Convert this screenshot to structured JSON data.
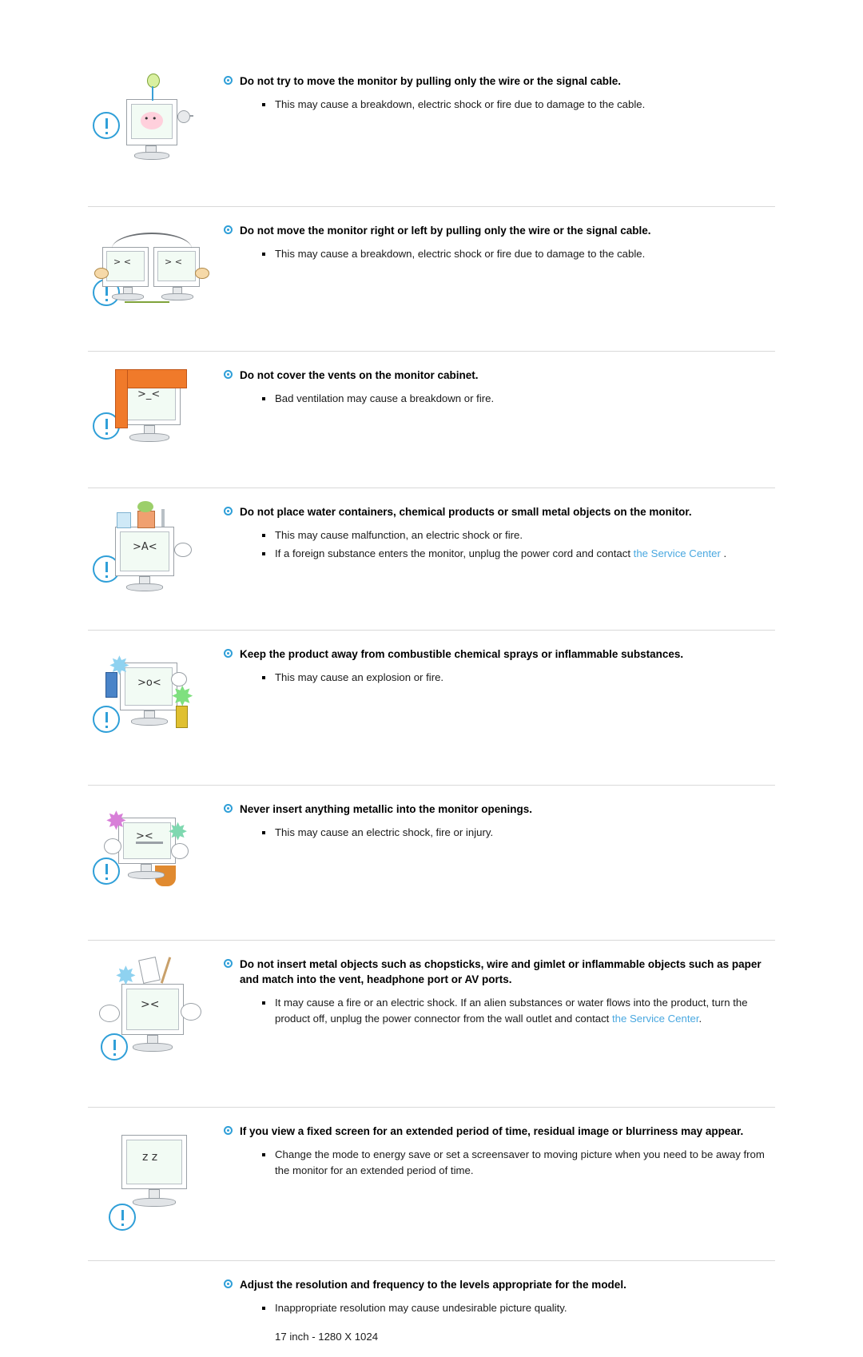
{
  "document": {
    "sections": [
      {
        "id": "move-by-cable",
        "heading": "Do not try to move the monitor by pulling only the wire or the signal cable.",
        "items": [
          "This may cause a breakdown, electric shock or fire due to damage to the cable."
        ]
      },
      {
        "id": "move-right-left",
        "heading": "Do not move the monitor right or left by pulling only the wire or the signal cable.",
        "items": [
          "This may cause a breakdown, electric shock or fire due to damage to the cable."
        ]
      },
      {
        "id": "cover-vents",
        "heading": "Do not cover the vents on the monitor cabinet.",
        "items": [
          "Bad ventilation may cause a breakdown or fire."
        ]
      },
      {
        "id": "water-containers",
        "heading": "Do not place water containers, chemical products or small metal objects on the monitor.",
        "items": [
          "This may cause malfunction, an electric shock or fire."
        ],
        "items_rich": [
          {
            "pre": "If a foreign substance enters the monitor, unplug the power cord and contact ",
            "link": "the Service Center",
            "post": " ."
          }
        ]
      },
      {
        "id": "combustible-sprays",
        "heading": "Keep the product away from combustible chemical sprays or inflammable substances.",
        "items": [
          "This may cause an explosion or fire."
        ]
      },
      {
        "id": "metallic-openings",
        "heading": "Never insert anything metallic into the monitor openings.",
        "items": [
          "This may cause an electric shock, fire or injury."
        ]
      },
      {
        "id": "metal-objects-vent",
        "heading": "Do not insert metal objects such as chopsticks, wire and gimlet or inflammable objects such as paper and match into the vent, headphone port or AV ports.",
        "items": [],
        "items_rich": [
          {
            "pre": "It may cause a fire or an electric shock. If an alien substances or water flows into the product, turn the product off, unplug the power connector from the wall outlet and contact ",
            "link": "the Service Center",
            "post": "."
          }
        ]
      },
      {
        "id": "fixed-screen",
        "heading": "If you view a fixed screen for an extended period of time, residual image or blurriness may appear.",
        "items": [
          "Change the mode to energy save or set a screensaver to moving picture when you need to be away from the monitor for an extended period of time."
        ]
      },
      {
        "id": "resolution-frequency",
        "heading": "Adjust the resolution and frequency to the levels appropriate for the model.",
        "items": [
          "Inappropriate resolution may cause undesirable picture quality."
        ],
        "note": "17 inch - 1280 X 1024"
      }
    ]
  },
  "colors": {
    "accent": "#2f9fd8",
    "link": "#4aa8e0",
    "rule": "#d9d9d9",
    "text": "#1a1a1a"
  },
  "icons": {
    "warning": "exclamation-circle-icon",
    "heading_bullet": "ring-bullet-icon",
    "item_bullet": "square-bullet-icon"
  }
}
